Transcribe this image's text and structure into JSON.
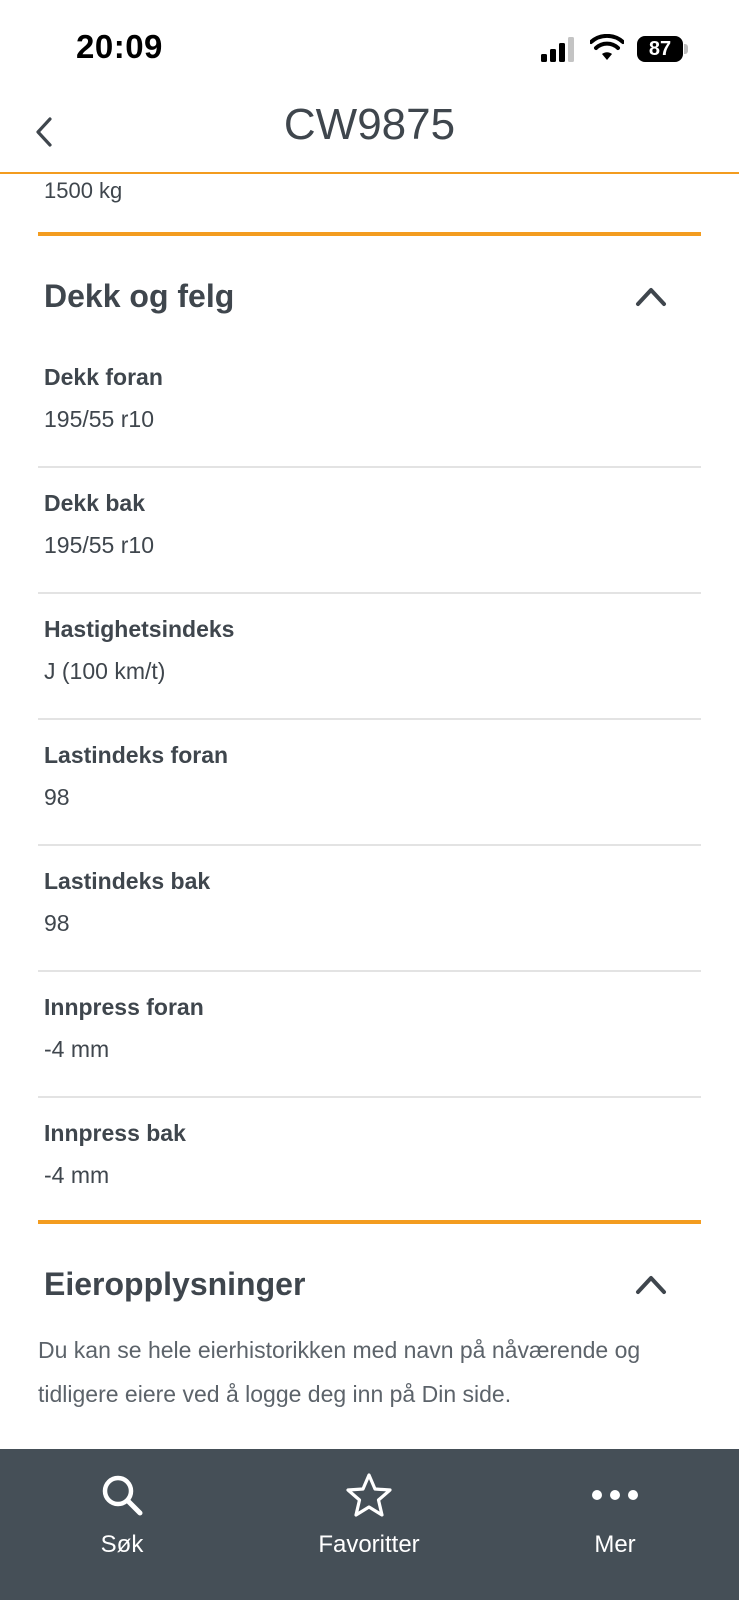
{
  "status_bar": {
    "time": "20:09",
    "battery": "87"
  },
  "nav": {
    "title": "CW9875",
    "back_icon": "chevron-left-icon"
  },
  "previous_field": {
    "value": "1500 kg"
  },
  "tires_section": {
    "title": "Dekk og felg",
    "expanded": true,
    "fields": [
      {
        "label": "Dekk foran",
        "value": "195/55 r10"
      },
      {
        "label": "Dekk bak",
        "value": "195/55 r10"
      },
      {
        "label": "Hastighetsindeks",
        "value": "J (100  km/t)"
      },
      {
        "label": "Lastindeks foran",
        "value": "98"
      },
      {
        "label": "Lastindeks bak",
        "value": "98"
      },
      {
        "label": "Innpress foran",
        "value": "-4 mm"
      },
      {
        "label": "Innpress bak",
        "value": "-4 mm"
      }
    ]
  },
  "owner_section": {
    "title": "Eieropplysninger",
    "expanded": true,
    "text_line1": "Du kan se hele eierhistorikken med navn på nåværende og",
    "text_line2": "tidligere eiere ved å logge deg inn på Din side."
  },
  "tab_bar": {
    "tabs": [
      {
        "label": "Søk",
        "icon": "search-icon"
      },
      {
        "label": "Favoritter",
        "icon": "star-icon"
      },
      {
        "label": "Mer",
        "icon": "more-icon"
      }
    ]
  },
  "colors": {
    "accent": "#f39c1f",
    "text": "#3f464d",
    "tab_bar_bg": "#454f57",
    "divider": "#e3e3e3"
  }
}
